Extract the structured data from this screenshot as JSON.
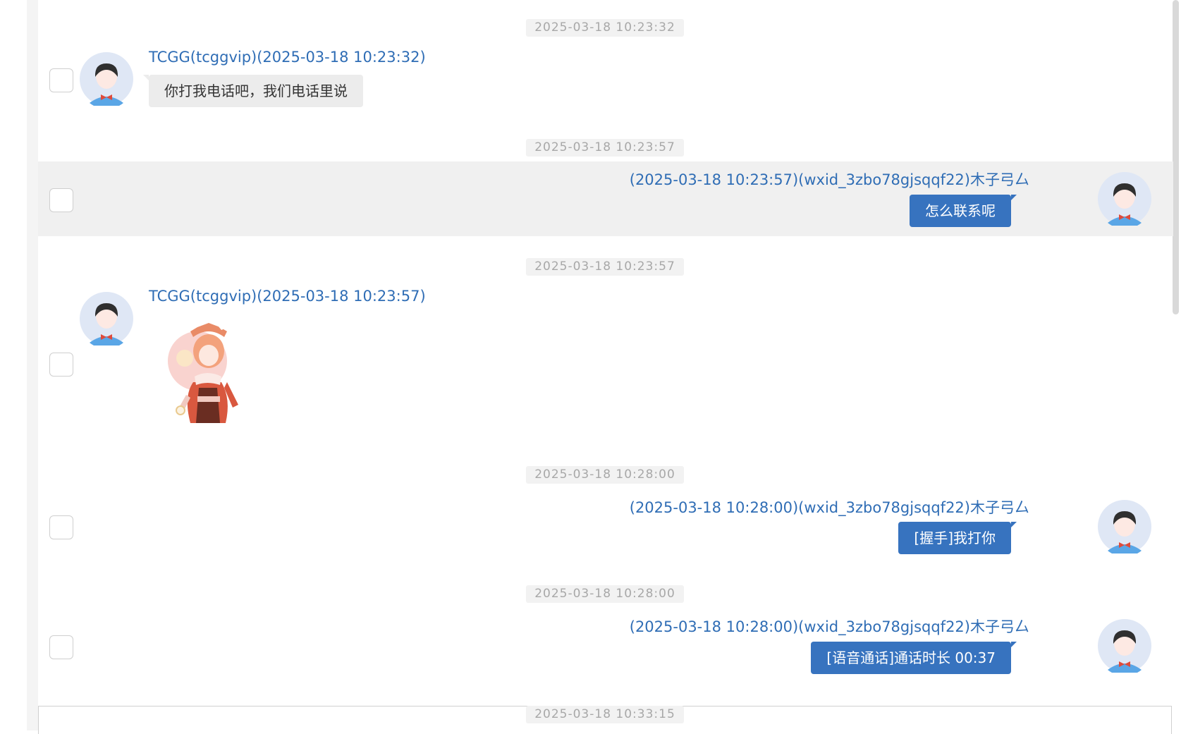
{
  "messages": [
    {
      "timestamp": "2025-03-18 10:23:32",
      "sender": "TCGG(tcggvip)(2025-03-18 10:23:32)",
      "text": "你打我电话吧，我们电话里说",
      "direction": "in"
    },
    {
      "timestamp": "2025-03-18 10:23:57",
      "sender": "(2025-03-18 10:23:57)(wxid_3zbo78gjsqqf22)木子弓厶",
      "text": "怎么联系呢",
      "direction": "out"
    },
    {
      "timestamp": "2025-03-18 10:23:57",
      "sender": "TCGG(tcggvip)(2025-03-18 10:23:57)",
      "text": "",
      "direction": "in",
      "content": "sticker-image"
    },
    {
      "timestamp": "2025-03-18 10:28:00",
      "sender": "(2025-03-18 10:28:00)(wxid_3zbo78gjsqqf22)木子弓厶",
      "text": "[握手]我打你",
      "direction": "out"
    },
    {
      "timestamp": "2025-03-18 10:28:00",
      "sender": "(2025-03-18 10:28:00)(wxid_3zbo78gjsqqf22)木子弓厶",
      "text": "[语音通话]通话时长 00:37",
      "direction": "out"
    },
    {
      "timestamp": "2025-03-18 10:33:15",
      "sender": "",
      "text": "",
      "direction": "in"
    }
  ],
  "colors": {
    "link": "#2f6db5",
    "bubble_out": "#3773bf",
    "bubble_in": "#ececec",
    "timestamp_text": "#a8a8a8",
    "row_highlight": "#f0f0f0"
  },
  "icons": [
    "default-avatar-icon",
    "checkbox-icon"
  ]
}
